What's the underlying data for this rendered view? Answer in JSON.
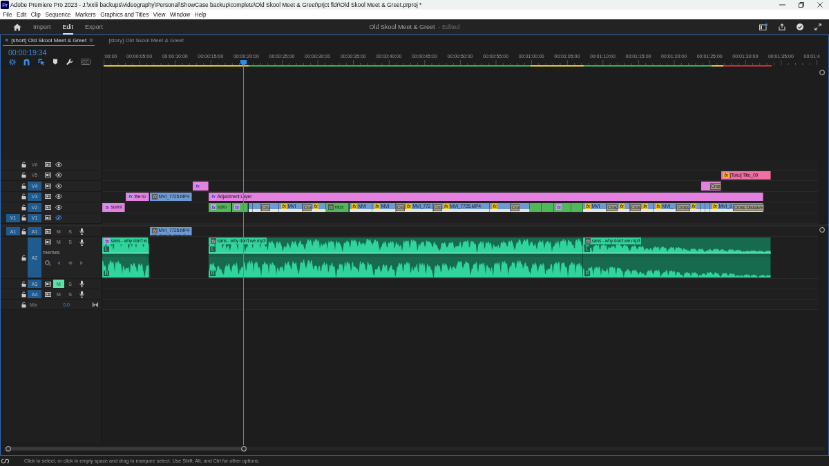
{
  "window": {
    "app_icon": "Pr",
    "title": "Adobe Premiere Pro 2023 - J:\\xxiii backups\\videography\\Personal\\ShowCase backup\\complete\\Old Skool Meet & Greet\\prjct fldr\\Old Skool Meet & Greet.prproj *"
  },
  "menu": [
    "File",
    "Edit",
    "Clip",
    "Sequence",
    "Markers",
    "Graphics and Titles",
    "View",
    "Window",
    "Help"
  ],
  "workspace": {
    "tabs": [
      {
        "label": "Import",
        "selected": false
      },
      {
        "label": "Edit",
        "selected": true
      },
      {
        "label": "Export",
        "selected": false
      }
    ],
    "project": "Old Skool Meet & Greet",
    "project_state": "- Edited"
  },
  "panel_tabs": [
    {
      "label": "[short] Old Skool Meet & Greet",
      "selected": true,
      "close": "×",
      "menu": "≡"
    },
    {
      "label": "[story] Old Skool Meet & Greet",
      "selected": false
    }
  ],
  "timecode": "00:00:19:34",
  "tools": [
    {
      "kind": "nest",
      "on": true
    },
    {
      "kind": "snap",
      "on": true
    },
    {
      "kind": "linked",
      "on": true
    },
    {
      "kind": "marker",
      "on": false
    },
    {
      "kind": "settings",
      "on": false
    },
    {
      "kind": "captions",
      "on": false,
      "label": "CC"
    }
  ],
  "ruler": {
    "labels": [
      ":00:00",
      "00:00:05:00",
      "00:00:10:00",
      "00:00:15:00",
      "00:00:20:00",
      "00:00:25:00",
      "00:00:30:00",
      "00:00:35:00",
      "00:00:40:00",
      "00:00:45:00",
      "00:00:50:00",
      "00:00:55:00",
      "00:01:00:00",
      "00:01:05:00",
      "00:01:10:00",
      "00:01:15:00",
      "00:01:20:00",
      "00:01:25:00",
      "00:01:30:00",
      "00:01:35:00",
      "00:01:4"
    ],
    "render_bar": [
      {
        "color": "#e3c21e"
      },
      {
        "color": "#2fb34e"
      },
      {
        "color": "#e3c21e"
      },
      {
        "color": "#2fb34e"
      },
      {
        "color": "#e3c21e"
      },
      {
        "color": "#d42b2b"
      }
    ]
  },
  "video_tracks": [
    {
      "name": "V6",
      "targeted": false,
      "locked": false,
      "visible": true
    },
    {
      "name": "V5",
      "targeted": false,
      "locked": false,
      "visible": true,
      "items": [
        {
          "kind": "plain",
          "label": "[Toko] Title_09",
          "badge": "fx",
          "effect_applied": false,
          "intrinsic_modified": true,
          "color": "#f26fa4"
        }
      ]
    },
    {
      "name": "V4",
      "targeted": true,
      "locked": false,
      "visible": true,
      "items": [
        {
          "kind": "plain",
          "badge": "fx",
          "effect_applied": true,
          "intrinsic_modified": false,
          "color": "#e281de"
        },
        {
          "kind": "plain",
          "color": "#e281de",
          "transition_out": "Cros"
        }
      ]
    },
    {
      "name": "V3",
      "targeted": true,
      "locked": false,
      "visible": true,
      "items": [
        {
          "kind": "plain",
          "label": "the ru",
          "badge": "fx",
          "effect_applied": true,
          "intrinsic_modified": false,
          "color": "#e281de"
        },
        {
          "kind": "plain",
          "label": "MVI_7725.MP4",
          "badge": "fx",
          "effect_applied": false,
          "intrinsic_modified": false,
          "color": "#6e9ad4"
        },
        {
          "kind": "plain",
          "label": "Adjustment Layer",
          "badge": "fx",
          "effect_applied": true,
          "intrinsic_modified": false,
          "color": "#e281de"
        }
      ]
    },
    {
      "name": "V2",
      "targeted": true,
      "locked": false,
      "visible": true,
      "items": [
        {
          "kind": "plain",
          "label": "sunni",
          "badge": "fx",
          "effect_applied": true,
          "intrinsic_modified": false,
          "color": "#e281de"
        },
        {
          "kind": "plain",
          "label": "sciro",
          "badge": "fx",
          "effect_applied": true,
          "intrinsic_modified": false,
          "color": "#50b85a"
        },
        {
          "kind": "plain",
          "badge": "fx",
          "effect_applied": true,
          "intrinsic_modified": false,
          "color": "#50b85a"
        },
        {
          "kind": "banded",
          "color": "#6e9ad4"
        },
        {
          "kind": "banded",
          "color": "#6e9ad4"
        },
        {
          "kind": "banded",
          "color": "#6e9ad4",
          "transition_in": "Cro"
        },
        {
          "kind": "banded",
          "label": "MVI",
          "badge": "fx",
          "effect_applied": false,
          "intrinsic_modified": true,
          "color": "#6e9ad4"
        },
        {
          "kind": "banded",
          "badge": "fx",
          "effect_applied": false,
          "intrinsic_modified": true,
          "color": "#6e9ad4",
          "transition_in": "Cro"
        },
        {
          "kind": "plain",
          "label": "raca",
          "badge": "fx",
          "effect_applied": false,
          "intrinsic_modified": false,
          "color": "#50b85a"
        },
        {
          "kind": "banded",
          "label": "MVI",
          "badge": "fx",
          "effect_applied": false,
          "intrinsic_modified": true,
          "color": "#6e9ad4"
        },
        {
          "kind": "banded",
          "label": "MVI",
          "badge": "fx",
          "effect_applied": false,
          "intrinsic_modified": true,
          "color": "#6e9ad4"
        },
        {
          "kind": "banded",
          "label": "MVI_772",
          "badge": "fx",
          "effect_applied": false,
          "intrinsic_modified": true,
          "color": "#6e9ad4",
          "transition_in": "Cro"
        },
        {
          "kind": "banded",
          "label": "MVI_7725.MP4",
          "badge": "fx",
          "effect_applied": false,
          "intrinsic_modified": true,
          "color": "#6e9ad4",
          "transition_in": "Cro"
        },
        {
          "kind": "banded",
          "badge": "fx",
          "effect_applied": false,
          "intrinsic_modified": true,
          "color": "#6e9ad4"
        },
        {
          "kind": "banded",
          "color": "#6e9ad4",
          "transition_in": "Cro"
        },
        {
          "kind": "plain",
          "color": "#50b85a"
        },
        {
          "kind": "plain",
          "color": "#50b85a"
        },
        {
          "kind": "plain",
          "badge": "fx",
          "effect_applied": true,
          "intrinsic_modified": false,
          "color": "#50b85a"
        },
        {
          "kind": "plain",
          "color": "#50b85a"
        },
        {
          "kind": "banded",
          "label": "MVI",
          "badge": "fx",
          "effect_applied": false,
          "intrinsic_modified": true,
          "color": "#6e9ad4"
        },
        {
          "kind": "banded",
          "badge": "fx",
          "effect_applied": false,
          "intrinsic_modified": true,
          "color": "#6e9ad4",
          "transition_in": "Cros"
        },
        {
          "kind": "banded",
          "badge": "fx",
          "effect_applied": false,
          "intrinsic_modified": true,
          "color": "#6e9ad4",
          "transition_in": "Cros"
        },
        {
          "kind": "banded",
          "label": "MVI_",
          "badge": "fx",
          "effect_applied": false,
          "intrinsic_modified": true,
          "color": "#6e9ad4"
        },
        {
          "kind": "banded",
          "badge": "fx",
          "effect_applied": false,
          "intrinsic_modified": true,
          "color": "#6e9ad4",
          "transition_in": "Cross"
        },
        {
          "kind": "banded",
          "color": "#6e9ad4"
        },
        {
          "kind": "banded",
          "color": "#6e9ad4"
        },
        {
          "kind": "banded",
          "label": "MVI_9",
          "badge": "fx",
          "effect_applied": false,
          "intrinsic_modified": true,
          "color": "#6e9ad4",
          "transition_out": "Cross Dissolve"
        }
      ]
    },
    {
      "name": "V1",
      "source_patch": "V1",
      "targeted": true,
      "locked": false,
      "visible": false
    }
  ],
  "audio_tracks": [
    {
      "name": "A1",
      "source_patch": "A1",
      "targeted": true,
      "locked": false,
      "expanded": false,
      "mute": "M",
      "solo": "S",
      "muted": false,
      "soloed": false,
      "items": [
        {
          "label": "MVI_7725.MP4",
          "badge": "fx",
          "effect_applied": false,
          "intrinsic_modified": false,
          "color": "#6e9ad4"
        }
      ]
    },
    {
      "name": "A2",
      "targeted": true,
      "locked": false,
      "expanded": true,
      "track_label": "memes",
      "mute": "M",
      "solo": "S",
      "muted": false,
      "soloed": false,
      "items": [
        {
          "label": "sans - why don't w",
          "badge": "fx",
          "effect_applied": true,
          "intrinsic_modified": false,
          "color": "#2fd59c",
          "channels": [
            "L",
            "R"
          ]
        },
        {
          "label": "sans - why don't we.mp3",
          "badge": "fx",
          "effect_applied": false,
          "intrinsic_modified": false,
          "color": "#2fd59c",
          "channels": [
            "L",
            "R"
          ]
        },
        {
          "label": "sans - why don't we.mp3",
          "badge": "fx",
          "effect_applied": false,
          "intrinsic_modified": false,
          "color": "#2fd59c",
          "channels": [
            "L",
            "R"
          ]
        }
      ]
    },
    {
      "name": "A3",
      "targeted": true,
      "locked": false,
      "expanded": false,
      "mute": "M",
      "solo": "S",
      "muted": true,
      "soloed": false
    },
    {
      "name": "A4",
      "targeted": true,
      "locked": false,
      "expanded": false,
      "mute": "M",
      "solo": "S",
      "muted": false,
      "soloed": false
    }
  ],
  "mix_track": {
    "name": "Mix",
    "value": "0.0",
    "locked": false
  },
  "status_bar": "Click to select, or click in empty space and drag to marquee select. Use Shift, Alt, and Ctrl for other options."
}
